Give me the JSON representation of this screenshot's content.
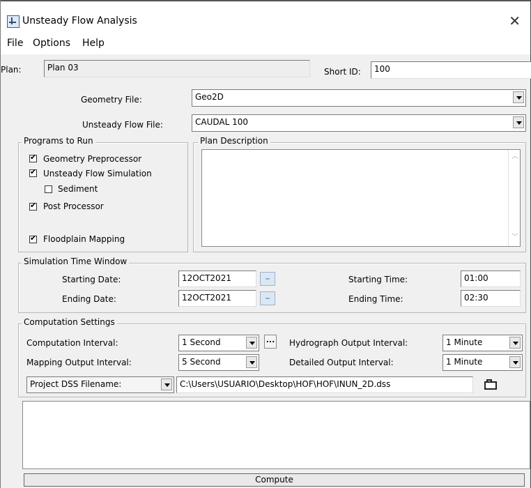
{
  "window": {
    "title": "Unsteady Flow Analysis",
    "close": "✕"
  },
  "menu": [
    "File",
    "Options",
    "Help"
  ],
  "plan": {
    "label": "Plan:",
    "value": "Plan 03",
    "short_id_label": "Short ID:",
    "short_id_value": "100"
  },
  "geometry": {
    "label": "Geometry File:",
    "value": "Geo2D"
  },
  "unsteady": {
    "label": "Unsteady Flow File:",
    "value": "CAUDAL 100"
  },
  "programs": {
    "title": "Programs to Run",
    "items": [
      {
        "label": "Geometry Preprocessor",
        "checked": true
      },
      {
        "label": "Unsteady Flow Simulation",
        "checked": true
      },
      {
        "label": "Sediment",
        "checked": false
      },
      {
        "label": "Post Processor",
        "checked": true
      },
      {
        "label": "Floodplain Mapping",
        "checked": true
      }
    ]
  },
  "plan_description": {
    "title": "Plan Description",
    "value": ""
  },
  "simulation_window": {
    "title": "Simulation Time Window",
    "starting_date_label": "Starting Date:",
    "starting_date": "12OCT2021",
    "ending_date_label": "Ending Date:",
    "ending_date": "12OCT2021",
    "starting_time_label": "Starting Time:",
    "starting_time": "01:00",
    "ending_time_label": "Ending Time:",
    "ending_time": "02:30"
  },
  "computation": {
    "title": "Computation Settings",
    "interval_label": "Computation Interval:",
    "interval": "1 Second",
    "hydrograph_label": "Hydrograph Output Interval:",
    "hydrograph": "1 Minute",
    "mapping_label": "Mapping Output Interval:",
    "mapping": "5 Second",
    "detailed_label": "Detailed Output Interval:",
    "detailed": "1 Minute",
    "dss_select": "Project DSS Filename:",
    "dss_path": "C:\\Users\\USUARIO\\Desktop\\HOF\\HOF\\INUN_2D.dss"
  },
  "compute_button": "Compute"
}
